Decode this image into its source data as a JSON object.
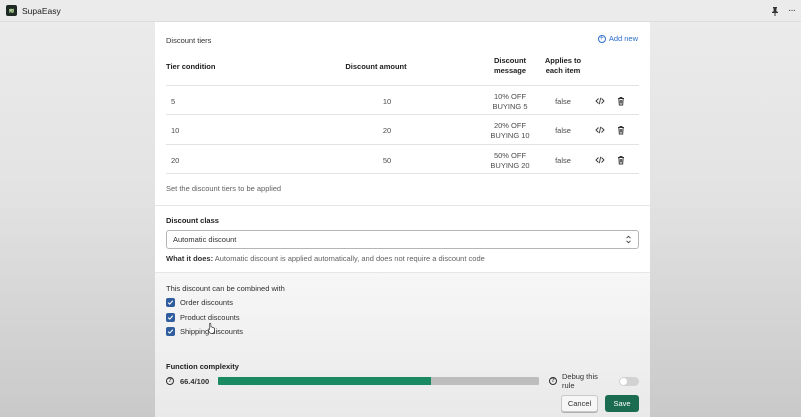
{
  "app": {
    "title": "SupaEasy",
    "logo_glyph": "≋"
  },
  "topbar": {
    "pin_icon": "pin-icon",
    "more_icon": "more-horizontal-icon",
    "more_glyph": "···"
  },
  "tiers": {
    "title": "Discount tiers",
    "add_new_label": "Add new",
    "columns": {
      "condition": "Tier condition",
      "amount": "Discount amount",
      "message_line1": "Discount",
      "message_line2": "message",
      "applies_line1": "Applies to",
      "applies_line2": "each item"
    },
    "rows": [
      {
        "condition": "5",
        "amount": "10",
        "message_line1": "10% OFF",
        "message_line2": "BUYING 5",
        "applies": "false"
      },
      {
        "condition": "10",
        "amount": "20",
        "message_line1": "20% OFF",
        "message_line2": "BUYING 10",
        "applies": "false"
      },
      {
        "condition": "20",
        "amount": "50",
        "message_line1": "50% OFF",
        "message_line2": "BUYING 20",
        "applies": "false"
      }
    ],
    "help_text": "Set the discount tiers to be applied"
  },
  "discount_class": {
    "label": "Discount class",
    "selected": "Automatic discount",
    "what_label": "What it does:",
    "what_text": " Automatic discount is applied automatically, and does not require a discount code"
  },
  "combine": {
    "title": "This discount can be combined with",
    "options": [
      {
        "label": "Order discounts",
        "checked": true
      },
      {
        "label": "Product discounts",
        "checked": true
      },
      {
        "label": "Shipping discounts",
        "checked": true
      }
    ]
  },
  "complexity": {
    "title": "Function complexity",
    "score_text": "66.4/100",
    "score_fraction": 0.664,
    "debug_label": "Debug this rule",
    "debug_enabled": false
  },
  "actions": {
    "cancel": "Cancel",
    "save": "Save"
  },
  "colors": {
    "primary": "#1b6b50",
    "progress": "#1a8a61",
    "link": "#2c6ecb",
    "checkbox": "#2f5d9e"
  }
}
